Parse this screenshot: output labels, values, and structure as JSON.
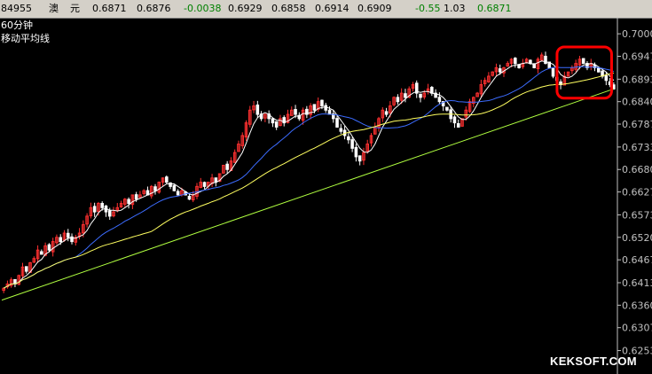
{
  "quote_bar": {
    "code": "84955",
    "name_1": "澳",
    "name_2": "元",
    "last": "0.6871",
    "price_2": "0.6876",
    "change": "-0.0038",
    "price_3": "0.6929",
    "price_4": "0.6858",
    "price_5": "0.6914",
    "price_6": "0.6909",
    "change_pct": "-0.55",
    "ratio": "1.03",
    "price_7": "0.6871"
  },
  "panel": {
    "title": "60分钟",
    "indicator": "移动平均线"
  },
  "watermark": "KEKSOFT.COM",
  "colors": {
    "up": "#ff3030",
    "down": "#ffffff",
    "ma_short": "#ffffff",
    "ma_mid": "#ffff60",
    "ma_long": "#3c6cff",
    "trendline": "#b0ff40",
    "highlight": "#ff0000",
    "axis_text": "#c0c0c0",
    "quote_up": "#008000",
    "quote_down": "#008000"
  },
  "chart_data": {
    "type": "candlestick",
    "timeframe": "60分钟",
    "y_ticks": [
      "0.7000",
      "0.6947",
      "0.6893",
      "0.6840",
      "0.6787",
      "0.6733",
      "0.6680",
      "0.6627",
      "0.6573",
      "0.6520",
      "0.6467",
      "0.6413",
      "0.6360",
      "0.6307",
      "0.6253"
    ],
    "ylim": [
      0.6227,
      0.7017
    ],
    "bar_count": 160,
    "close_series": [
      0.64,
      0.641,
      0.642,
      0.641,
      0.643,
      0.645,
      0.644,
      0.646,
      0.647,
      0.649,
      0.648,
      0.65,
      0.649,
      0.651,
      0.652,
      0.651,
      0.653,
      0.652,
      0.651,
      0.652,
      0.653,
      0.655,
      0.657,
      0.659,
      0.658,
      0.66,
      0.659,
      0.658,
      0.657,
      0.658,
      0.659,
      0.66,
      0.661,
      0.66,
      0.662,
      0.661,
      0.662,
      0.663,
      0.662,
      0.664,
      0.663,
      0.665,
      0.666,
      0.665,
      0.664,
      0.663,
      0.662,
      0.663,
      0.662,
      0.661,
      0.662,
      0.664,
      0.665,
      0.664,
      0.665,
      0.666,
      0.665,
      0.667,
      0.669,
      0.668,
      0.67,
      0.672,
      0.674,
      0.676,
      0.679,
      0.682,
      0.683,
      0.681,
      0.68,
      0.681,
      0.68,
      0.679,
      0.678,
      0.68,
      0.679,
      0.681,
      0.682,
      0.681,
      0.68,
      0.682,
      0.681,
      0.683,
      0.682,
      0.684,
      0.683,
      0.682,
      0.681,
      0.68,
      0.678,
      0.677,
      0.676,
      0.675,
      0.673,
      0.671,
      0.67,
      0.672,
      0.674,
      0.676,
      0.678,
      0.68,
      0.682,
      0.681,
      0.683,
      0.685,
      0.684,
      0.686,
      0.685,
      0.687,
      0.688,
      0.686,
      0.685,
      0.686,
      0.687,
      0.686,
      0.685,
      0.684,
      0.683,
      0.682,
      0.68,
      0.679,
      0.678,
      0.68,
      0.682,
      0.684,
      0.685,
      0.686,
      0.688,
      0.689,
      0.69,
      0.691,
      0.692,
      0.691,
      0.692,
      0.693,
      0.694,
      0.693,
      0.692,
      0.693,
      0.694,
      0.693,
      0.692,
      0.694,
      0.695,
      0.693,
      0.692,
      0.69,
      0.689,
      0.688,
      0.69,
      0.691,
      0.692,
      0.693,
      0.694,
      0.693,
      0.692,
      0.693,
      0.692,
      0.691,
      0.69,
      0.689,
      0.688,
      0.687
    ],
    "trendline": {
      "start_value": 0.6372,
      "end_value": 0.687
    },
    "highlight": {
      "from_bar": 147,
      "to_bar": 159
    },
    "moving_averages": [
      {
        "period": 5,
        "color_key": "ma_short"
      },
      {
        "period": 20,
        "color_key": "ma_long"
      },
      {
        "period": 40,
        "color_key": "ma_mid"
      }
    ]
  }
}
